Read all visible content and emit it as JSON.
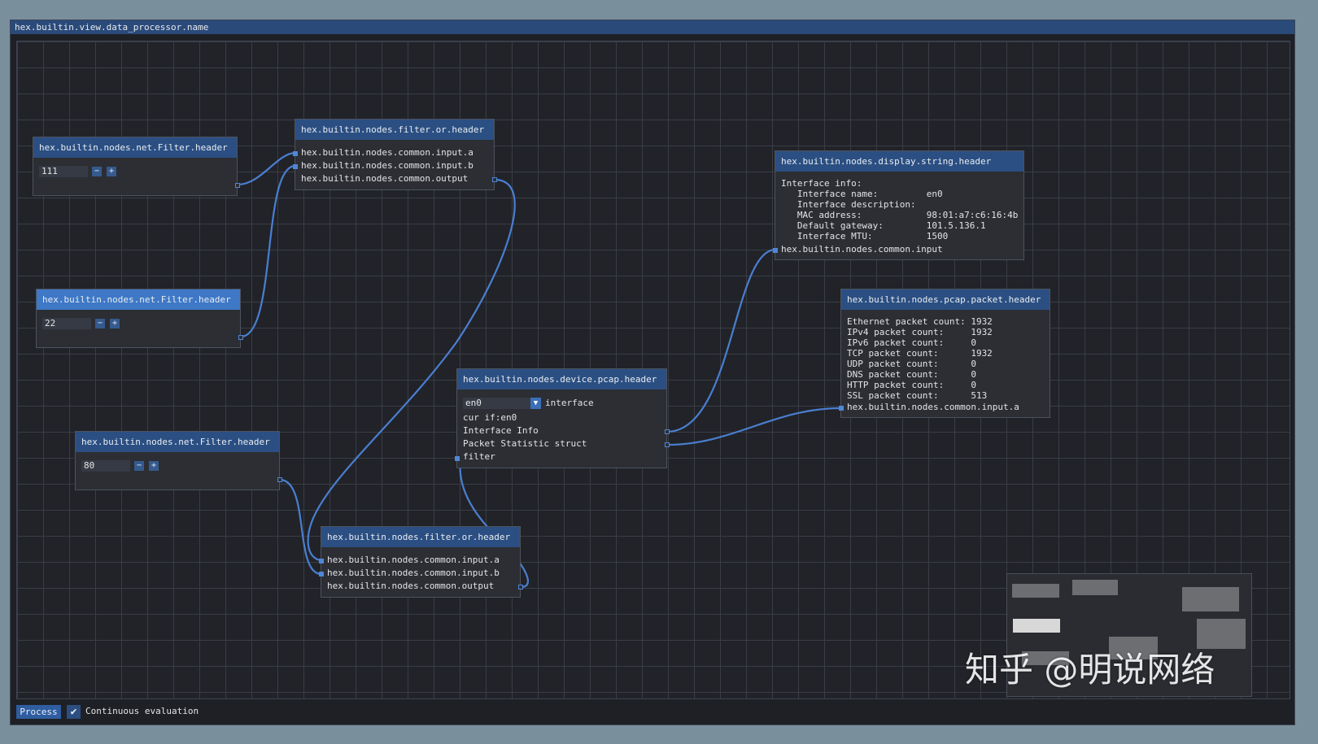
{
  "window": {
    "title": "hex.builtin.view.data_processor.name"
  },
  "nodes": {
    "filter1": {
      "header": "hex.builtin.nodes.net.Filter.header",
      "value": "111",
      "minus": "−",
      "plus": "+"
    },
    "filter2": {
      "header": "hex.builtin.nodes.net.Filter.header",
      "value": "22",
      "minus": "−",
      "plus": "+"
    },
    "filter3": {
      "header": "hex.builtin.nodes.net.Filter.header",
      "value": "80",
      "minus": "−",
      "plus": "+"
    },
    "or1": {
      "header": "hex.builtin.nodes.filter.or.header",
      "input_a": "hex.builtin.nodes.common.input.a",
      "input_b": "hex.builtin.nodes.common.input.b",
      "output": "hex.builtin.nodes.common.output"
    },
    "or2": {
      "header": "hex.builtin.nodes.filter.or.header",
      "input_a": "hex.builtin.nodes.common.input.a",
      "input_b": "hex.builtin.nodes.common.input.b",
      "output": "hex.builtin.nodes.common.output"
    },
    "pcap": {
      "header": "hex.builtin.nodes.device.pcap.header",
      "interface_value": "en0",
      "interface_label": "interface",
      "cur_if": "cur if:en0",
      "interface_info": "Interface Info",
      "packet_stat": "Packet Statistic struct",
      "filter": "filter"
    },
    "display": {
      "header": "hex.builtin.nodes.display.string.header",
      "lines": [
        "Interface info:",
        "   Interface name:         en0",
        "   Interface description:",
        "   MAC address:            98:01:a7:c6:16:4b",
        "   Default gateway:        101.5.136.1",
        "   Interface MTU:          1500"
      ],
      "input": "hex.builtin.nodes.common.input"
    },
    "packet": {
      "header": "hex.builtin.nodes.pcap.packet.header",
      "lines": [
        "Ethernet packet count: 1932",
        "IPv4 packet count:     1932",
        "IPv6 packet count:     0",
        "TCP packet count:      1932",
        "UDP packet count:      0",
        "DNS packet count:      0",
        "HTTP packet count:     0",
        "SSL packet count:      513"
      ],
      "input_a": "hex.builtin.nodes.common.input.a"
    }
  },
  "footer": {
    "process_label": "Process",
    "check_mark": "✔",
    "continuous_label": "Continuous evaluation"
  },
  "watermark": "知乎 @明说网络",
  "colors": {
    "link": "#4a7fd0",
    "header": "#2b4f82",
    "header_selected": "#3e78c6"
  }
}
